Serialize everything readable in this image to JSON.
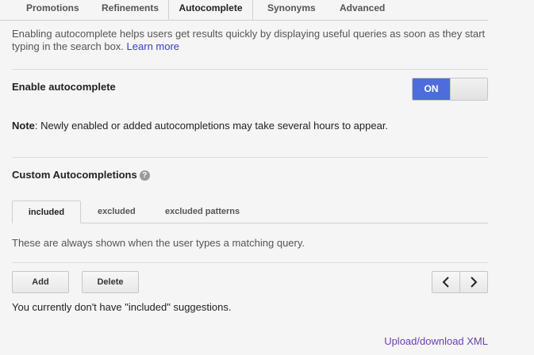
{
  "top_tabs": {
    "promotions": "Promotions",
    "refinements": "Refinements",
    "autocomplete": "Autocomplete",
    "synonyms": "Synonyms",
    "advanced": "Advanced",
    "active": "Autocomplete"
  },
  "intro": {
    "text": "Enabling autocomplete helps users get results quickly by displaying useful queries as soon as they start typing in the search box.",
    "learn_more": "Learn more"
  },
  "enable": {
    "label": "Enable autocomplete",
    "toggle_state": "ON"
  },
  "note": {
    "prefix": "Note",
    "text": ": Newly enabled or added autocompletions may take several hours to appear."
  },
  "custom": {
    "title": "Custom Autocompletions",
    "help_icon": "help-icon",
    "tabs": {
      "included": "included",
      "excluded": "excluded",
      "excluded_patterns": "excluded patterns",
      "active": "included"
    },
    "description": "These are always shown when the user types a matching query.",
    "add_label": "Add",
    "delete_label": "Delete",
    "empty_message": "You currently don't have \"included\" suggestions."
  },
  "footer": {
    "upload_link": "Upload/download XML"
  },
  "colors": {
    "toggle_on": "#4d6ddc",
    "link": "#3b3bc9",
    "visited_link": "#6a3fb3",
    "background": "#f5f5f5"
  }
}
